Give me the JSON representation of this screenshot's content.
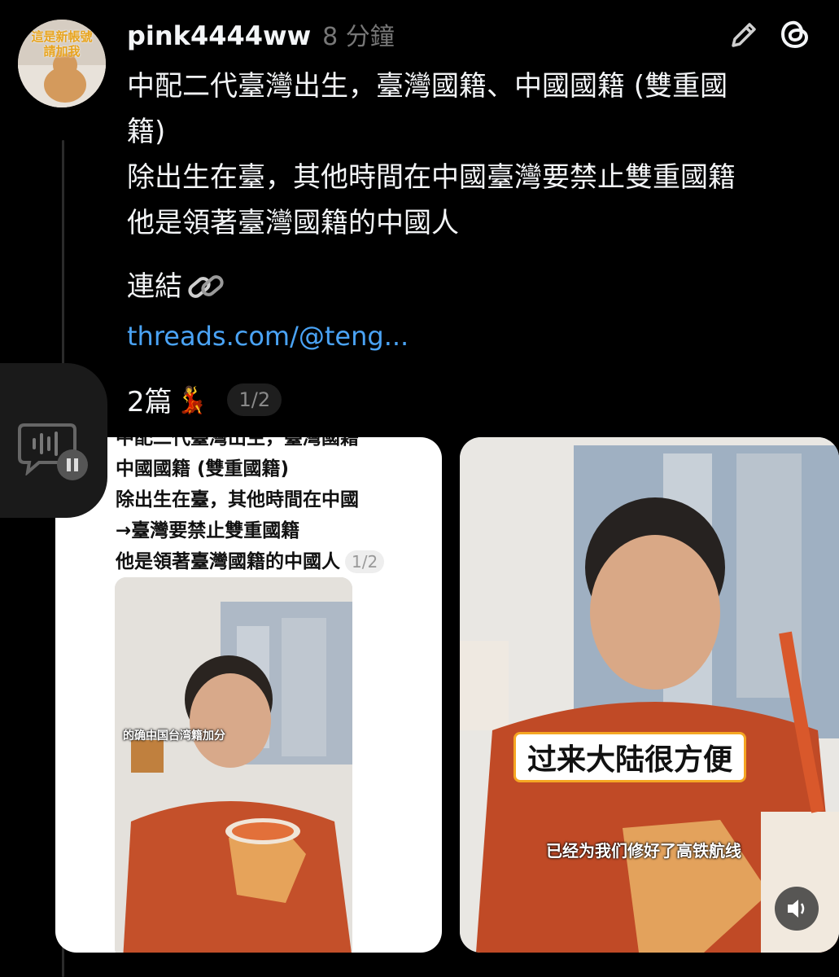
{
  "post": {
    "avatar_text": "這是新帳號\n請加我",
    "username": "pink4444ww",
    "timestamp": "8 分鐘",
    "lines": [
      "中配二代臺灣出生，臺灣國籍、中國國籍 (雙重國",
      "籍)",
      "除出生在臺，其他時間在中國臺灣要禁止雙重國籍",
      "他是領著臺灣國籍的中國人"
    ],
    "link_label": "連結",
    "link_url": "threads.com/@teng...",
    "count_text": "2篇",
    "count_emoji": "💃",
    "page_badge": "1/2"
  },
  "media": {
    "card1": {
      "lines": [
        "中配二代臺灣出生，臺灣國籍",
        "中國國籍 (雙重國籍)",
        "除出生在臺，其他時間在中國",
        "→臺灣要禁止雙重國籍",
        "他是領著臺灣國籍的中國人"
      ],
      "badge": "1/2",
      "inner_caption": "的确中国台湾籍加分"
    },
    "card2": {
      "caption_big": "过来大陆很方便",
      "caption_small": "已经为我们修好了高铁航线"
    }
  },
  "icons": [
    "edit-icon",
    "threads-logo-icon",
    "link-icon",
    "voice-message-icon",
    "pause-icon",
    "sound-icon"
  ],
  "colors": {
    "background": "#000000",
    "text": "#f3f5f7",
    "muted": "#777777",
    "link": "#4aa3f5",
    "caption_border": "#f5a623"
  }
}
